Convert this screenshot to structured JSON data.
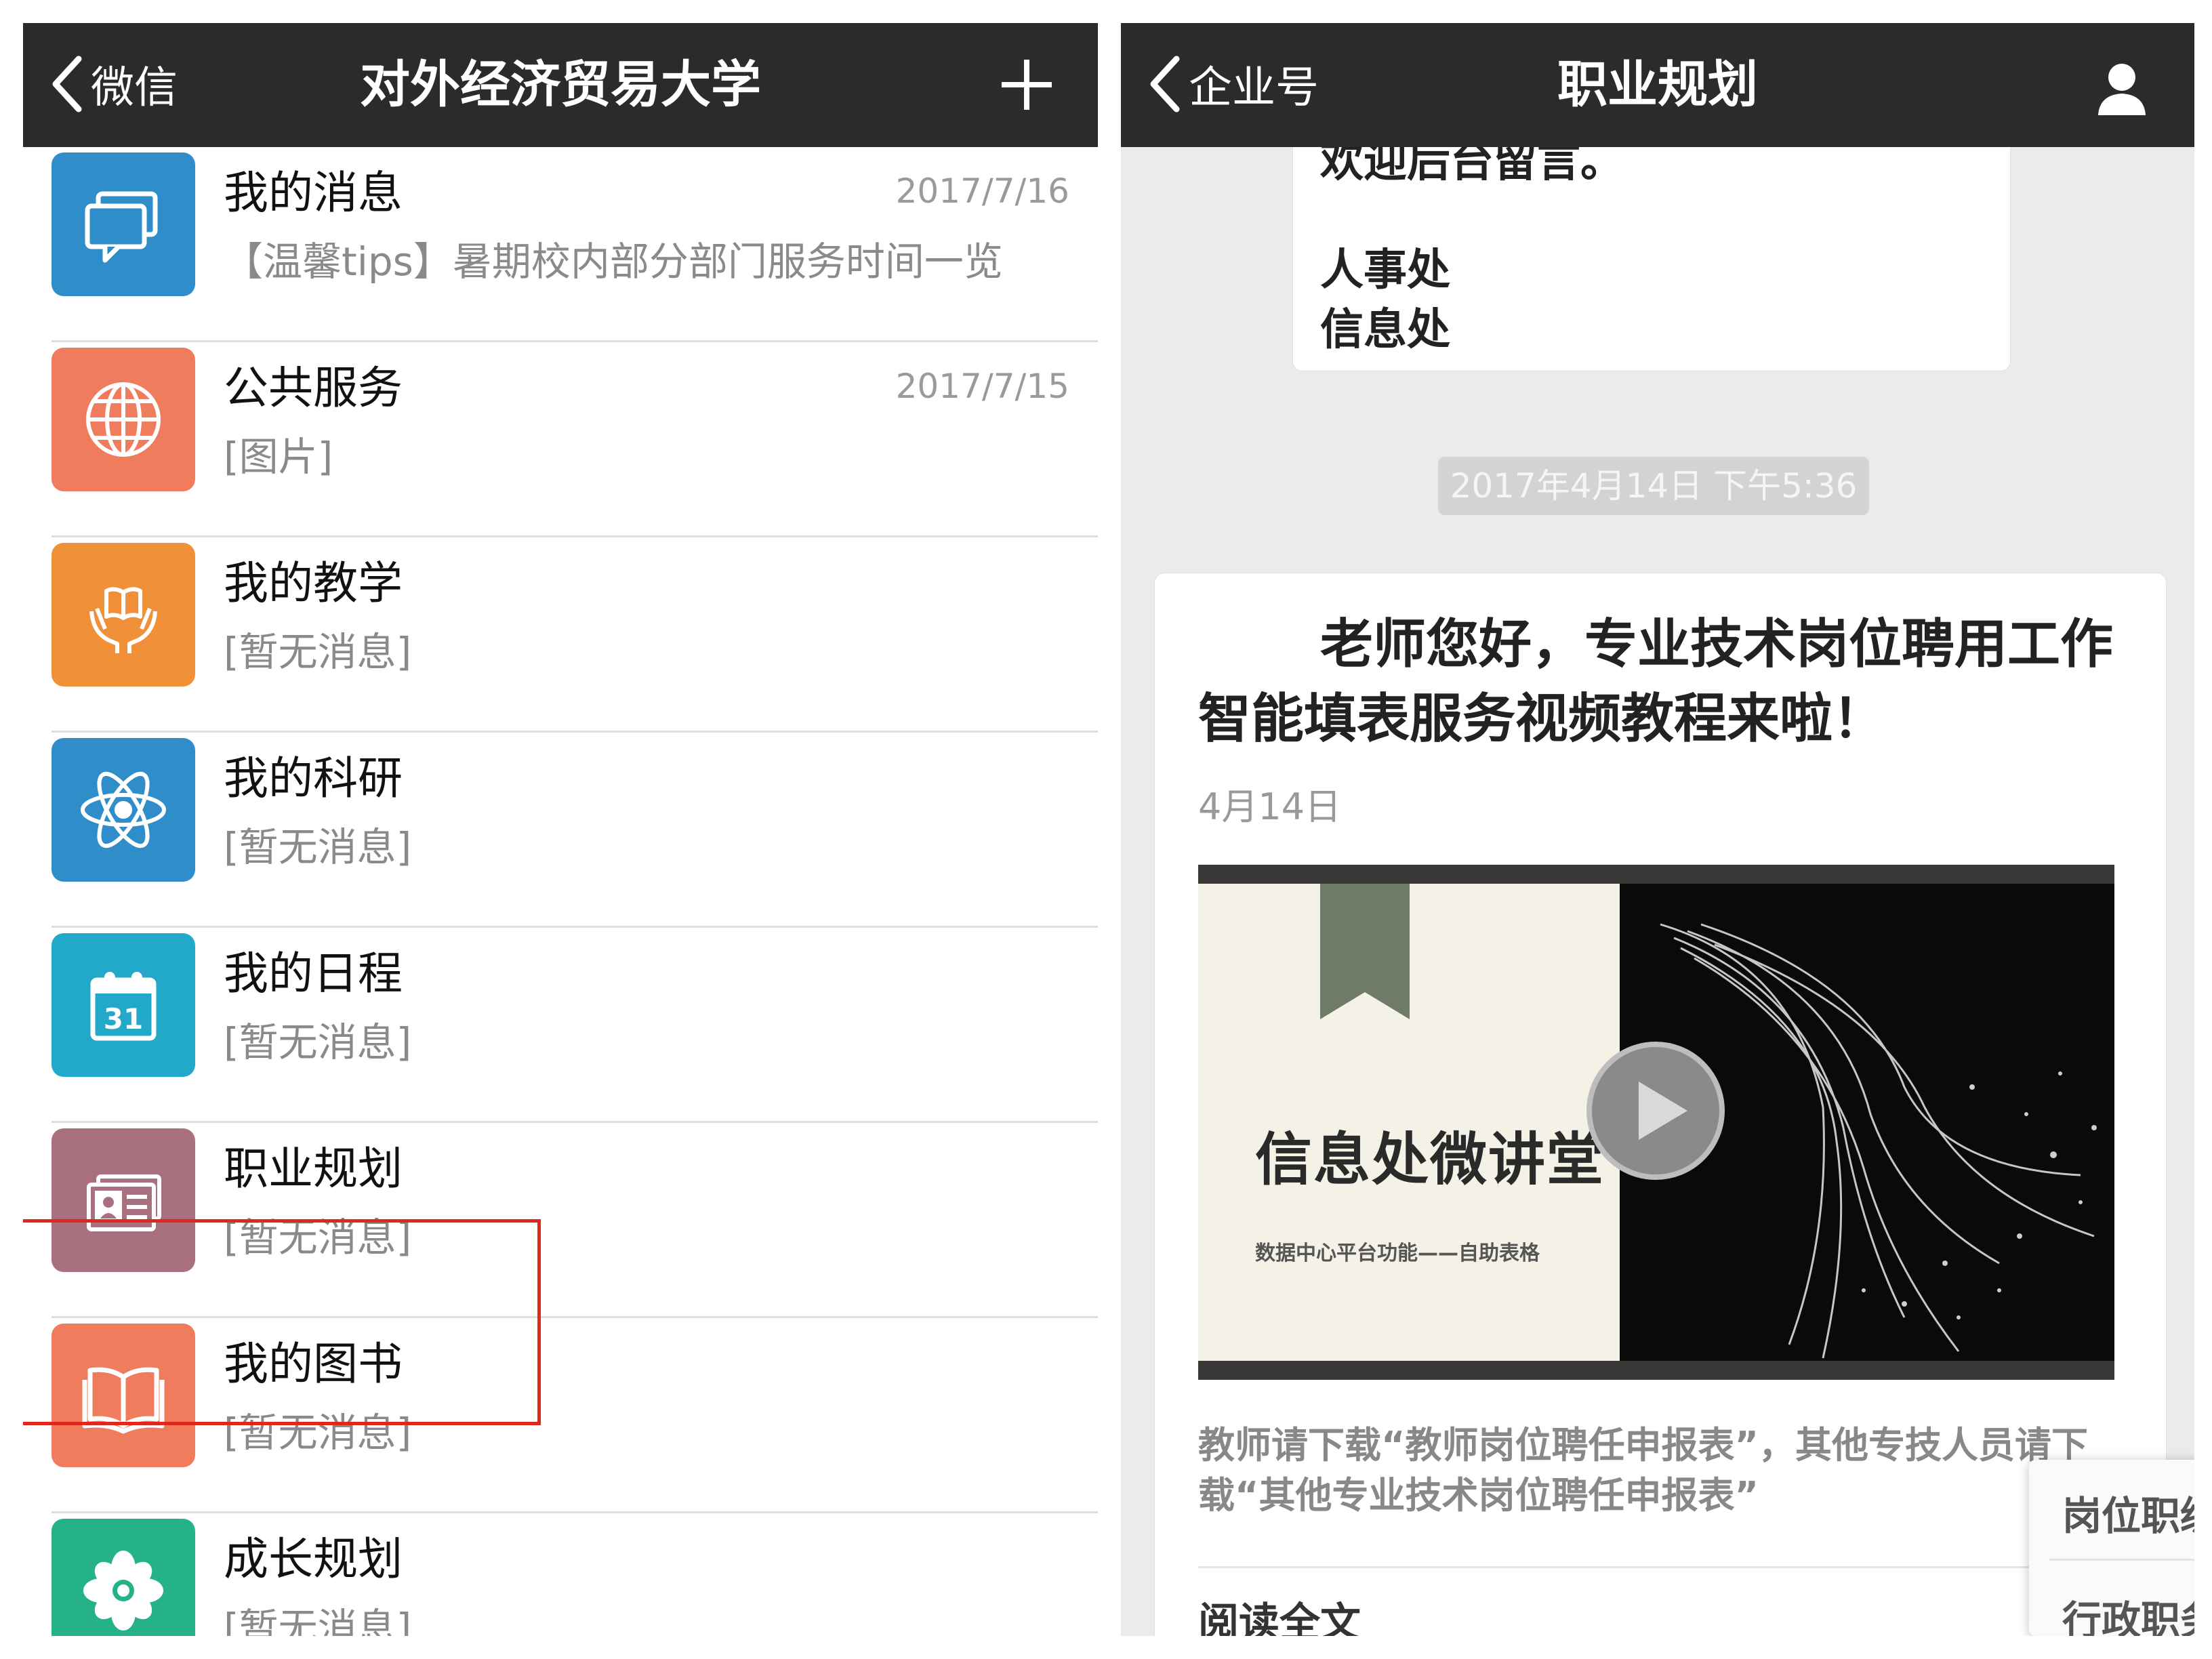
{
  "left": {
    "nav": {
      "back_label": "微信",
      "title": "对外经济贸易大学"
    },
    "items": [
      {
        "title": "我的消息",
        "subtitle": "【温馨tips】暑期校内部分部门服务时间一览",
        "date": "2017/7/16",
        "icon": "chat-bubbles-icon",
        "color": "#2f8dc9"
      },
      {
        "title": "公共服务",
        "subtitle": "[图片]",
        "date": "2017/7/15",
        "icon": "globe-icon",
        "color": "#f07c5e"
      },
      {
        "title": "我的教学",
        "subtitle": "[暂无消息]",
        "date": "",
        "icon": "hands-book-icon",
        "color": "#f0913a"
      },
      {
        "title": "我的科研",
        "subtitle": "[暂无消息]",
        "date": "",
        "icon": "atom-icon",
        "color": "#2f8dc9"
      },
      {
        "title": "我的日程",
        "subtitle": "[暂无消息]",
        "date": "",
        "icon": "calendar-icon",
        "color": "#22a8c8"
      },
      {
        "title": "职业规划",
        "subtitle": "[暂无消息]",
        "date": "",
        "icon": "id-card-icon",
        "color": "#a9717f"
      },
      {
        "title": "我的图书",
        "subtitle": "[暂无消息]",
        "date": "",
        "icon": "open-book-icon",
        "color": "#f07c5e"
      },
      {
        "title": "成长规划",
        "subtitle": "[暂无消息]",
        "date": "",
        "icon": "flower-icon",
        "color": "#26b289"
      }
    ],
    "calendar_day": "31"
  },
  "right": {
    "nav": {
      "back_label": "企业号",
      "title": "职业规划"
    },
    "bubble": {
      "line1": "欢迎后台留言。",
      "line2": "人事处",
      "line3": "信息处"
    },
    "timestamp": "2017年4月14日 下午5:36",
    "card": {
      "title": "老师您好，专业技术岗位聘用工作智能填表服务视频教程来啦！",
      "date": "4月14日",
      "image_title": "信息处微讲堂",
      "image_subtitle": "数据中心平台功能——自助表格",
      "description": "教师请下载“教师岗位聘任申报表”，其他专技人员请下载“其他专业技术岗位聘任申报表”",
      "read_more": "阅读全文"
    },
    "popup": {
      "item1": "岗位职级",
      "item2": "行政职务"
    }
  }
}
